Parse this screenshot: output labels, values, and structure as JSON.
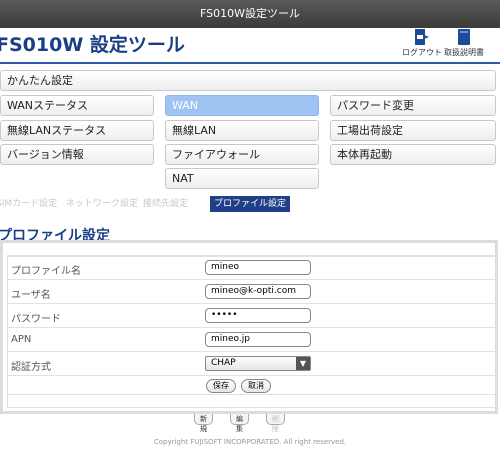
{
  "window": {
    "title": "FS010W設定ツール"
  },
  "header": {
    "app_title": "FS010W 設定ツール",
    "logout_label": "ログアウト",
    "manual_label": "取扱説明書"
  },
  "menu": {
    "easy_setup": "かんたん設定",
    "wan_status": "WANステータス",
    "wan": "WAN",
    "password_change": "パスワード変更",
    "wlan_status": "無線LANステータス",
    "wlan": "無線LAN",
    "factory_reset": "工場出荷設定",
    "version_info": "バージョン情報",
    "firewall": "ファイアウォール",
    "reboot": "本体再起動",
    "nat": "NAT"
  },
  "subtabs": {
    "sim_card": "SIMカード設定",
    "network": "ネットワーク設定",
    "connection": "接続先設定",
    "profile": "プロファイル設定"
  },
  "section_title": "プロファイル設定",
  "form": {
    "profile_name_label": "プロファイル名",
    "profile_name_value": "mineo",
    "username_label": "ユーザ名",
    "username_value": "mineo@k-opti.com",
    "password_label": "パスワード",
    "password_value": "•••••",
    "apn_label": "APN",
    "apn_value": "mineo.jp",
    "auth_label": "認証方式",
    "auth_value": "CHAP",
    "save_label": "保存",
    "cancel_label": "取消"
  },
  "bottom_buttons": {
    "new": "新規",
    "edit": "編集",
    "delete": "削除"
  },
  "footer": "Copyright FUJISOFT INCORPORATED. All right reserved."
}
